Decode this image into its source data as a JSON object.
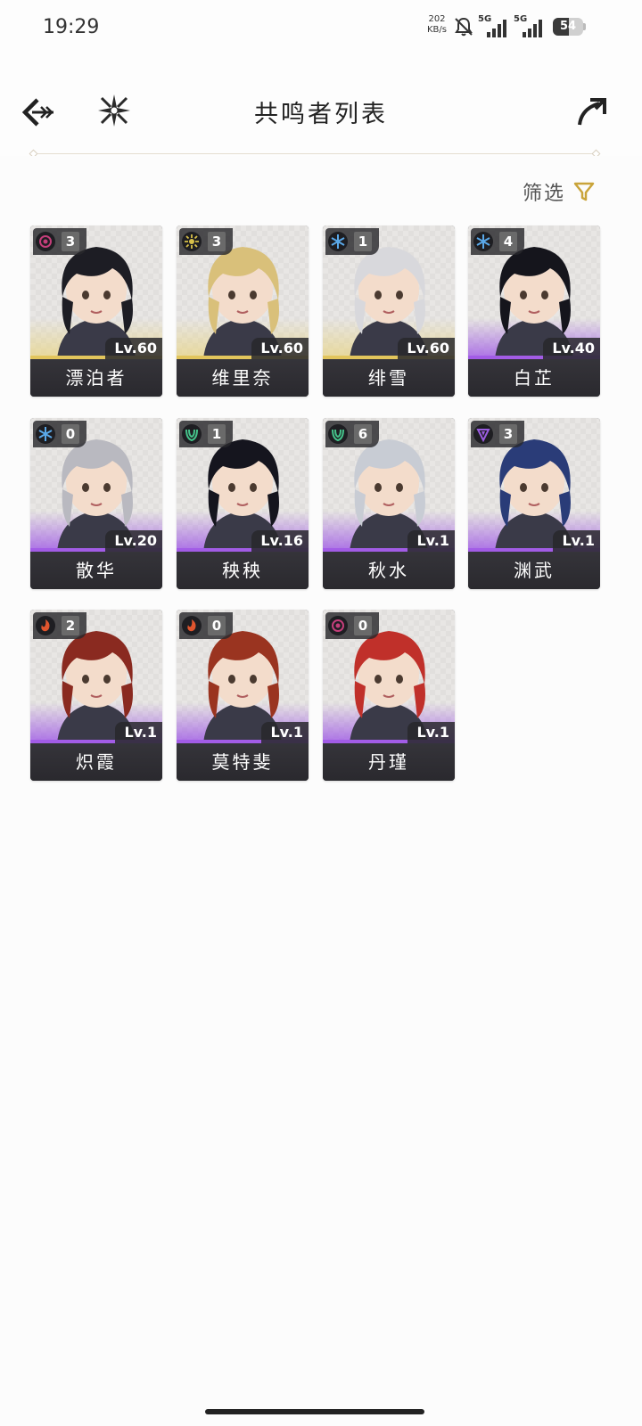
{
  "status_bar": {
    "time": "19:29",
    "net_speed_value": "202",
    "net_speed_unit": "KB/s",
    "signal_1_label": "5G",
    "signal_2_label": "5G",
    "battery_level": "54",
    "battery_fraction": 0.54
  },
  "header": {
    "title": "共鸣者列表",
    "back_icon": "back-arrow-icon",
    "logo_icon": "game-logo-icon",
    "share_icon": "share-arrow-icon"
  },
  "filter": {
    "label": "筛选",
    "icon": "filter-funnel-icon",
    "color": "#c9a43a"
  },
  "attributes": {
    "spectro": "#d8c04a",
    "havoc": "#c43e7a",
    "glacio": "#5aa8e8",
    "aero": "#45c28a",
    "fusion": "#e0552e",
    "electro": "#9a5ce0"
  },
  "characters": [
    {
      "name": "漂泊者",
      "level": "Lv.60",
      "chain": "3",
      "attribute": "havoc",
      "rarity": "gold"
    },
    {
      "name": "维里奈",
      "level": "Lv.60",
      "chain": "3",
      "attribute": "spectro",
      "rarity": "gold"
    },
    {
      "name": "绯雪",
      "level": "Lv.60",
      "chain": "1",
      "attribute": "glacio",
      "rarity": "gold"
    },
    {
      "name": "白芷",
      "level": "Lv.40",
      "chain": "4",
      "attribute": "glacio",
      "rarity": "purple"
    },
    {
      "name": "散华",
      "level": "Lv.20",
      "chain": "0",
      "attribute": "glacio",
      "rarity": "purple"
    },
    {
      "name": "秧秧",
      "level": "Lv.16",
      "chain": "1",
      "attribute": "aero",
      "rarity": "purple"
    },
    {
      "name": "秋水",
      "level": "Lv.1",
      "chain": "6",
      "attribute": "aero",
      "rarity": "purple"
    },
    {
      "name": "渊武",
      "level": "Lv.1",
      "chain": "3",
      "attribute": "electro",
      "rarity": "purple"
    },
    {
      "name": "炽霞",
      "level": "Lv.1",
      "chain": "2",
      "attribute": "fusion",
      "rarity": "purple"
    },
    {
      "name": "莫特斐",
      "level": "Lv.1",
      "chain": "0",
      "attribute": "fusion",
      "rarity": "purple"
    },
    {
      "name": "丹瑾",
      "level": "Lv.1",
      "chain": "0",
      "attribute": "havoc",
      "rarity": "purple"
    }
  ]
}
